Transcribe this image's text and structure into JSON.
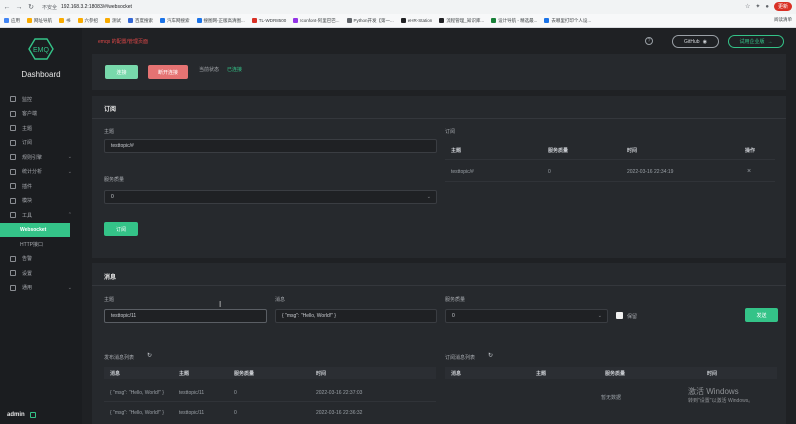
{
  "browser": {
    "insecure_label": "不安全",
    "url": "192.168.3.2:18083/#/websocket",
    "update_label": "更新",
    "bookmarks": [
      "应用",
      "网址导航",
      "书",
      "六参招",
      "测试",
      "百度搜索",
      "汽车网搜索",
      "搜图网-正版高清图...",
      "TL-WDR8500",
      "Iconfont-阿里巴巴...",
      "Python开发【第一...",
      "eHR-Station",
      "流程管理_知识库...",
      "设计导航 - 精选最...",
      "去哪里打印个人设..."
    ],
    "bookmarks_right": "阅读清单"
  },
  "sidebar": {
    "logo_text": "EMQ",
    "title": "Dashboard",
    "items": [
      {
        "label": "监控",
        "icon": "monitor-icon",
        "arrow": ""
      },
      {
        "label": "客户端",
        "icon": "clients-icon",
        "arrow": ""
      },
      {
        "label": "主题",
        "icon": "topics-icon",
        "arrow": ""
      },
      {
        "label": "订阅",
        "icon": "subscriptions-icon",
        "arrow": ""
      },
      {
        "label": "规则引擎",
        "icon": "rule-engine-icon",
        "arrow": "⌄"
      },
      {
        "label": "统计分析",
        "icon": "analysis-icon",
        "arrow": "⌄"
      },
      {
        "label": "插件",
        "icon": "plugins-icon",
        "arrow": ""
      },
      {
        "label": "模块",
        "icon": "modules-icon",
        "arrow": ""
      },
      {
        "label": "工具",
        "icon": "tools-icon",
        "arrow": "⌃"
      }
    ],
    "sub_items": [
      {
        "label": "Websocket",
        "active": true
      },
      {
        "label": "HTTP接口",
        "active": false
      }
    ],
    "items_after": [
      {
        "label": "告警",
        "icon": "alarm-icon",
        "arrow": ""
      },
      {
        "label": "设置",
        "icon": "settings-icon",
        "arrow": ""
      },
      {
        "label": "通用",
        "icon": "general-icon",
        "arrow": "⌄"
      }
    ],
    "user": "admin"
  },
  "header": {
    "title": "emqx 的配置/管理页面",
    "github_label": "GitHub",
    "enterprise_label": "试用企业版"
  },
  "connection": {
    "connect_label": "连接",
    "disconnect_label": "断开连接",
    "status_label": "当前状态",
    "status_value": "已连接"
  },
  "subscribe": {
    "title": "订阅",
    "topic_label": "主题",
    "topic_value": "testtopic/#",
    "qos_label": "服务质量",
    "qos_value": "0",
    "button_label": "订阅",
    "list_title": "订阅",
    "columns": [
      "主题",
      "服务质量",
      "时间",
      "操作"
    ],
    "rows": [
      {
        "topic": "testtopic/#",
        "qos": "0",
        "time": "2022-03-16 22:34:19",
        "action": "×"
      }
    ]
  },
  "message": {
    "title": "消息",
    "topic_label": "主题",
    "topic_value": "testtopic/11",
    "payload_label": "消息",
    "payload_value": "{ \"msg\": \"Hello, World!\" }",
    "qos_label": "服务质量",
    "qos_value": "0",
    "retain_label": "保留",
    "send_label": "发送",
    "published_title": "发布消息列表",
    "received_title": "订阅消息列表",
    "columns": [
      "消息",
      "主题",
      "服务质量",
      "时间"
    ],
    "published_rows": [
      {
        "msg": "{ \"msg\": \"Hello, World!\" }",
        "topic": "testtopic/11",
        "qos": "0",
        "time": "2022-03-16 22:37:03"
      },
      {
        "msg": "{ \"msg\": \"Hello, World!\" }",
        "topic": "testtopic/11",
        "qos": "0",
        "time": "2022-03-16 22:36:32"
      }
    ],
    "received_empty": "暂无数据"
  },
  "watermark": {
    "line1": "激活 Windows",
    "line2": "转到\"设置\"以激活 Windows。"
  },
  "colors": {
    "accent": "#34c388",
    "danger": "#e57373",
    "background": "#1f2124"
  }
}
